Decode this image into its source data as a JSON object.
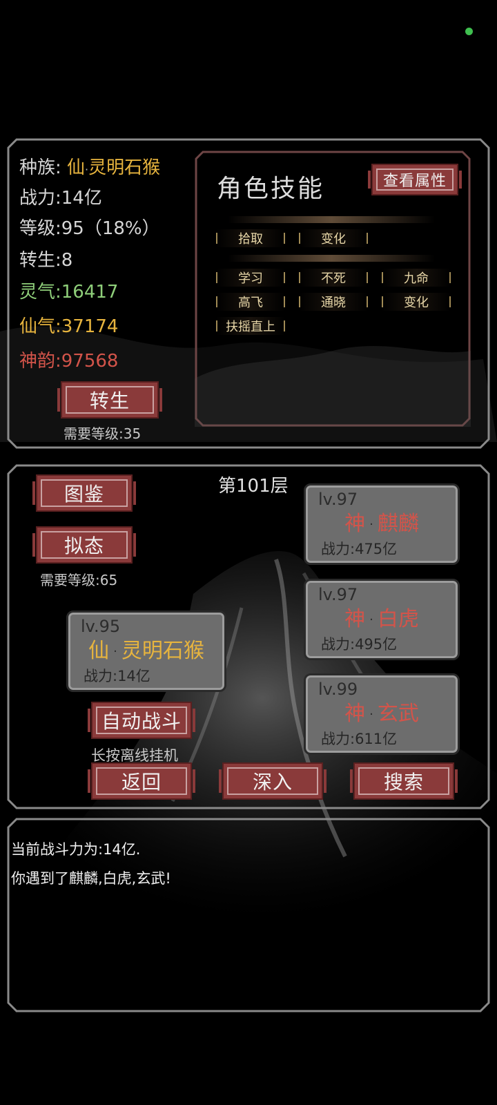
{
  "character": {
    "race_label": "种族:",
    "race_prefix": "仙",
    "race_name": "灵明石猴",
    "power_label": "战力:",
    "power_value": "14亿",
    "level_label": "等级:",
    "level_value": "95（18%）",
    "rebirth_label": "转生:",
    "rebirth_value": "8",
    "lingqi_label": "灵气:",
    "lingqi_value": "16417",
    "xianqi_label": "仙气:",
    "xianqi_value": "37174",
    "shenyun_label": "神韵:",
    "shenyun_value": "97568",
    "rebirth_button": "转生",
    "rebirth_requirement": "需要等级:35"
  },
  "skills": {
    "title": "角色技能",
    "view_attributes_button": "查看属性",
    "row1": [
      "拾取",
      "变化"
    ],
    "row2": [
      "学习",
      "不死",
      "九命"
    ],
    "row3": [
      "高飞",
      "通晓",
      "变化"
    ],
    "row4": [
      "扶摇直上"
    ]
  },
  "battle": {
    "floor": "第101层",
    "atlas_button": "图鉴",
    "mimic_button": "拟态",
    "mimic_requirement": "需要等级:65",
    "player": {
      "level": "lv.95",
      "prefix": "仙",
      "name": "灵明石猴",
      "power": "战力:14亿"
    },
    "enemies": [
      {
        "level": "lv.97",
        "prefix": "神",
        "name": "麒麟",
        "power": "战力:475亿"
      },
      {
        "level": "lv.97",
        "prefix": "神",
        "name": "白虎",
        "power": "战力:495亿"
      },
      {
        "level": "lv.99",
        "prefix": "神",
        "name": "玄武",
        "power": "战力:611亿"
      }
    ],
    "auto_battle_button": "自动战斗",
    "auto_battle_hint": "长按离线挂机",
    "back_button": "返回",
    "deeper_button": "深入",
    "search_button": "搜索"
  },
  "log": {
    "lines": [
      "当前战斗力为:14亿.",
      "你遇到了麒麟,白虎,玄武!"
    ]
  },
  "colors": {
    "gold": "#e7b43e",
    "green": "#8fcf7a",
    "red": "#d3544a",
    "button_red": "#8a3a3a",
    "status_dot": "#3fbf4f"
  }
}
